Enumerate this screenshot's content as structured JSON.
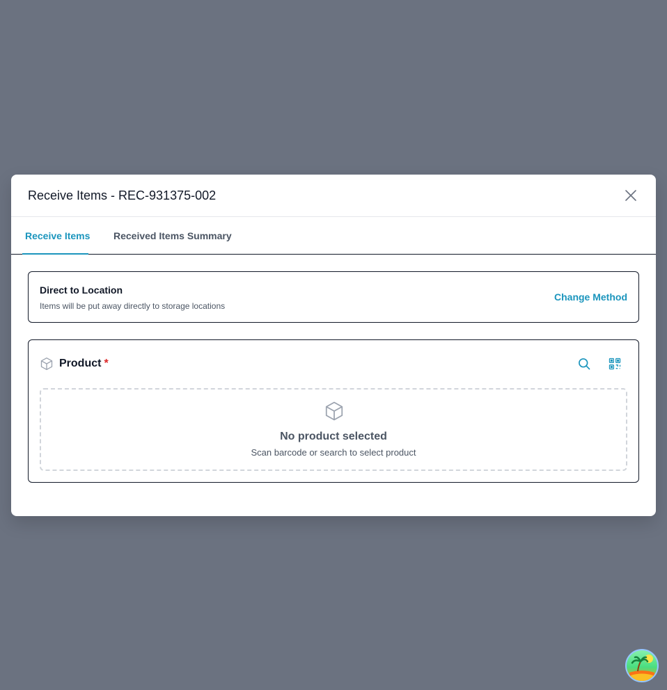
{
  "modal": {
    "title": "Receive Items - REC-931375-002"
  },
  "tabs": [
    {
      "label": "Receive Items",
      "active": true
    },
    {
      "label": "Received Items Summary",
      "active": false
    }
  ],
  "method": {
    "title": "Direct to Location",
    "description": "Items will be put away directly to storage locations",
    "change_label": "Change Method"
  },
  "product": {
    "label": "Product",
    "required_mark": "*",
    "empty_title": "No product selected",
    "empty_subtitle": "Scan barcode or search to select product"
  },
  "icons": {
    "close": "close-icon",
    "product": "box-icon",
    "search": "search-icon",
    "scan": "qr-code-icon",
    "empty": "box-icon",
    "fab": "island-icon"
  },
  "colors": {
    "accent": "#1b95bd",
    "backdrop": "#6b7280",
    "required": "#dc2626"
  }
}
